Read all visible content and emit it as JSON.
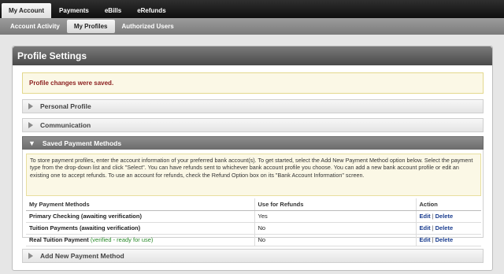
{
  "topnav": {
    "tabs": [
      {
        "label": "My Account",
        "active": true
      },
      {
        "label": "Payments",
        "active": false
      },
      {
        "label": "eBills",
        "active": false
      },
      {
        "label": "eRefunds",
        "active": false
      }
    ]
  },
  "subnav": {
    "tabs": [
      {
        "label": "Account Activity",
        "active": false
      },
      {
        "label": "My Profiles",
        "active": true
      },
      {
        "label": "Authorized Users",
        "active": false
      }
    ]
  },
  "panel": {
    "title": "Profile Settings",
    "success_message": "Profile changes were saved.",
    "sections": {
      "personal_profile": "Personal Profile",
      "communication": "Communication",
      "saved_payment_methods": "Saved Payment Methods",
      "add_new_payment_method": "Add New Payment Method"
    },
    "intro_text": "To store payment profiles, enter the account information of your preferred bank account(s). To get started, select the Add New Payment Method option below. Select the payment type from the drop-down list and click \"Select\". You can have refunds sent to whichever bank account profile you choose. You can add a new bank account profile or edit an existing one to accept refunds. To use an account for refunds, check the Refund Option box on its \"Bank Account Information\" screen.",
    "table": {
      "headers": [
        "My Payment Methods",
        "Use for Refunds",
        "Action"
      ],
      "rows": [
        {
          "method": "Primary Checking (awaiting verification)",
          "status": "",
          "refunds": "Yes",
          "edit": "Edit",
          "sep": "|",
          "delete": "Delete"
        },
        {
          "method": "Tuition Payments (awaiting verification)",
          "status": "",
          "refunds": "No",
          "edit": "Edit",
          "sep": "|",
          "delete": "Delete"
        },
        {
          "method": "Real Tuition Payment",
          "status": "(verified - ready for use)",
          "refunds": "No",
          "edit": "Edit",
          "sep": "|",
          "delete": "Delete"
        }
      ]
    }
  }
}
